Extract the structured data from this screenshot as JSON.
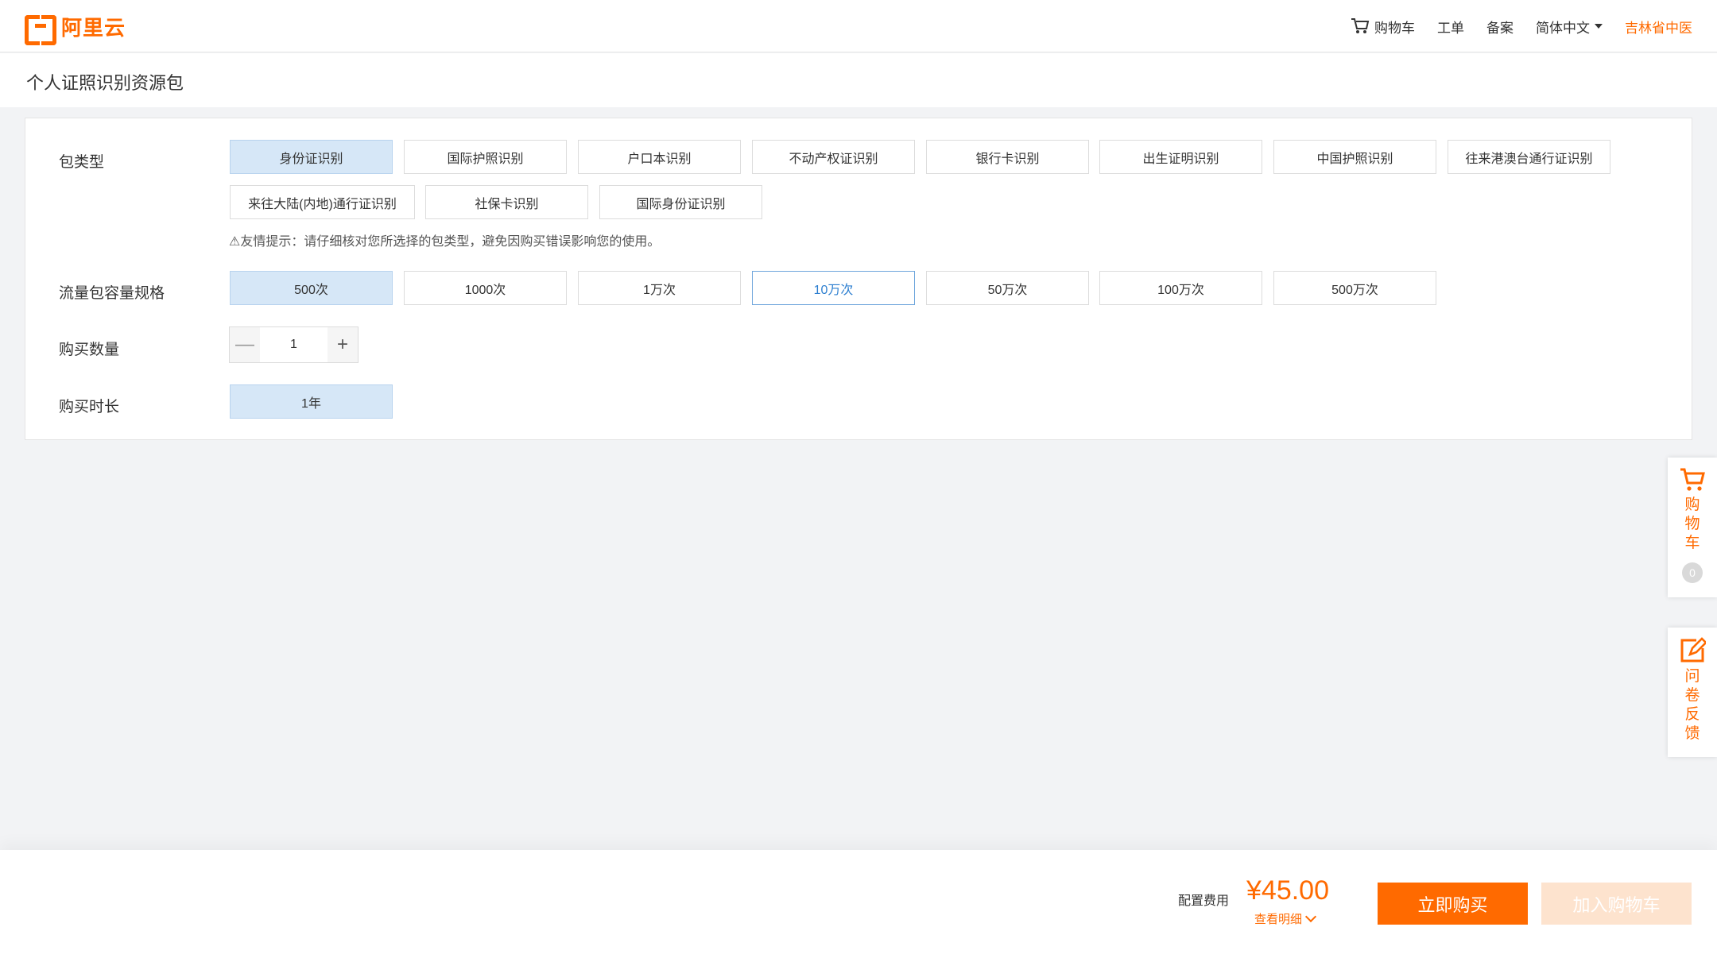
{
  "header": {
    "logo_text": "阿里云",
    "nav": {
      "cart": "购物车",
      "ticket": "工单",
      "filing": "备案",
      "language": "简体中文",
      "user": "吉林省中医"
    }
  },
  "page": {
    "title": "个人证照识别资源包"
  },
  "config": {
    "package_type": {
      "label": "包类型",
      "options": [
        "身份证识别",
        "国际护照识别",
        "户口本识别",
        "不动产权证识别",
        "银行卡识别",
        "出生证明识别",
        "中国护照识别",
        "往来港澳台通行证识别",
        "来往大陆(内地)通行证识别",
        "社保卡识别",
        "国际身份证识别"
      ],
      "selected": "身份证识别",
      "hint": "⚠友情提示：请仔细核对您所选择的包类型，避免因购买错误影响您的使用。"
    },
    "capacity": {
      "label": "流量包容量规格",
      "options": [
        "500次",
        "1000次",
        "1万次",
        "10万次",
        "50万次",
        "100万次",
        "500万次"
      ],
      "selected": "500次",
      "hovered": "10万次"
    },
    "quantity": {
      "label": "购买数量",
      "minus": "—",
      "value": "1",
      "plus": "+"
    },
    "duration": {
      "label": "购买时长",
      "options": [
        "1年"
      ],
      "selected": "1年"
    }
  },
  "side": {
    "cart_label": "购物车",
    "cart_count": "0",
    "feedback_label": "问卷反馈"
  },
  "footer": {
    "fee_label": "配置费用",
    "price": "¥45.00",
    "detail_link": "查看明细",
    "buy_now": "立即购买",
    "add_to_cart": "加入购物车"
  },
  "colors": {
    "accent": "#ff6a00",
    "selected_bg": "#d6e7f7",
    "link_blue": "#2d7fd0"
  }
}
